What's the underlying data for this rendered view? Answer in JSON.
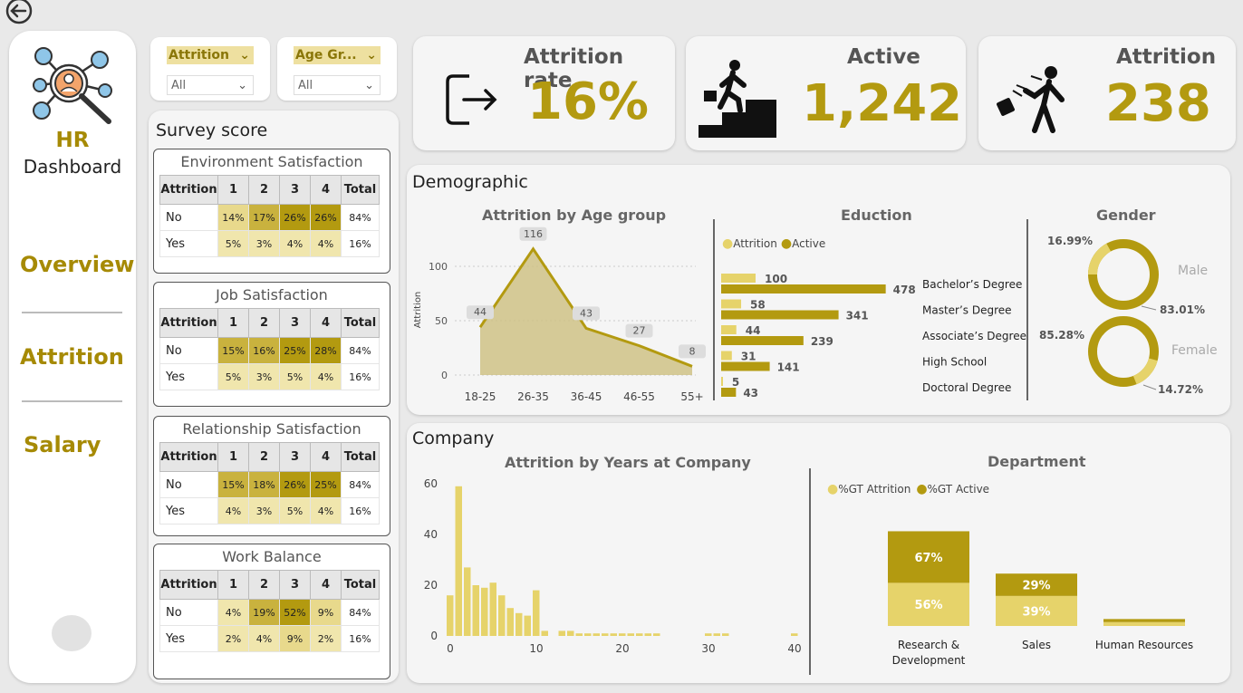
{
  "colors": {
    "gold_dark": "#a68a05",
    "gold_light": "#e6d36a",
    "cell_dark": "#b39a10",
    "cell_mid": "#c9b23e",
    "cell_light": "#e8d98c",
    "cell_pale": "#f0e6ad"
  },
  "sidebar": {
    "logo_title": "HR",
    "logo_sub": "Dashboard",
    "items": [
      {
        "label": "Overview"
      },
      {
        "label": "Attrition"
      },
      {
        "label": "Salary"
      }
    ]
  },
  "filters": [
    {
      "label": "Attrition",
      "value": "All"
    },
    {
      "label": "Age Gr...",
      "value": "All"
    }
  ],
  "survey": {
    "title": "Survey score",
    "columns": [
      "Attrition",
      "1",
      "2",
      "3",
      "4",
      "Total"
    ],
    "tables": [
      {
        "title": "Environment Satisfaction",
        "rows": [
          {
            "label": "No",
            "cells": [
              "14%",
              "17%",
              "26%",
              "26%"
            ],
            "total": "84%"
          },
          {
            "label": "Yes",
            "cells": [
              "5%",
              "3%",
              "4%",
              "4%"
            ],
            "total": "16%"
          }
        ]
      },
      {
        "title": "Job Satisfaction",
        "rows": [
          {
            "label": "No",
            "cells": [
              "15%",
              "16%",
              "25%",
              "28%"
            ],
            "total": "84%"
          },
          {
            "label": "Yes",
            "cells": [
              "5%",
              "3%",
              "5%",
              "4%"
            ],
            "total": "16%"
          }
        ]
      },
      {
        "title": "Relationship Satisfaction",
        "rows": [
          {
            "label": "No",
            "cells": [
              "15%",
              "18%",
              "26%",
              "25%"
            ],
            "total": "84%"
          },
          {
            "label": "Yes",
            "cells": [
              "4%",
              "3%",
              "5%",
              "4%"
            ],
            "total": "16%"
          }
        ]
      },
      {
        "title": "Work Balance",
        "rows": [
          {
            "label": "No",
            "cells": [
              "4%",
              "19%",
              "52%",
              "9%"
            ],
            "total": "84%"
          },
          {
            "label": "Yes",
            "cells": [
              "2%",
              "4%",
              "9%",
              "2%"
            ],
            "total": "16%"
          }
        ]
      }
    ]
  },
  "kpis": [
    {
      "title": "Attrition rate",
      "value": "16%",
      "icon": "exit-icon"
    },
    {
      "title": "Active",
      "value": "1,242",
      "icon": "climbing-stairs-icon"
    },
    {
      "title": "Attrition",
      "value": "238",
      "icon": "leaving-person-icon"
    }
  ],
  "demographic": {
    "title": "Demographic"
  },
  "company": {
    "title": "Company"
  },
  "chart_data": [
    {
      "type": "area",
      "title": "Attrition by Age group",
      "ylabel": "Attrition",
      "xlabel": "",
      "categories": [
        "18-25",
        "26-35",
        "36-45",
        "46-55",
        "55+"
      ],
      "values": [
        44,
        116,
        43,
        27,
        8
      ],
      "yticks": [
        0,
        50,
        100
      ],
      "ylim": [
        0,
        125
      ]
    },
    {
      "type": "bar",
      "title": "Eduction",
      "orientation": "horizontal",
      "categories": [
        "Bachelor's Degree",
        "Master's Degree",
        "Associate's Degree",
        "High School",
        "Doctoral Degree"
      ],
      "series": [
        {
          "name": "Attrition",
          "values": [
            100,
            58,
            44,
            31,
            5
          ]
        },
        {
          "name": "Active",
          "values": [
            478,
            341,
            239,
            141,
            43
          ]
        }
      ],
      "legend": "top-left"
    },
    {
      "type": "pie",
      "title": "Gender",
      "charts": [
        {
          "label": "Male",
          "slices": [
            {
              "label": "16.99%",
              "value": 16.99
            },
            {
              "label": "83.01%",
              "value": 83.01
            }
          ]
        },
        {
          "label": "Female",
          "slices": [
            {
              "label": "85.28%",
              "value": 85.28
            },
            {
              "label": "14.72%",
              "value": 14.72
            }
          ]
        }
      ]
    },
    {
      "type": "bar",
      "title": "Attrition by Years at Company",
      "xticks": [
        0,
        10,
        20,
        30,
        40
      ],
      "yticks": [
        0,
        20,
        40,
        60
      ],
      "ylim": [
        0,
        60
      ],
      "x": [
        0,
        1,
        2,
        3,
        4,
        5,
        6,
        7,
        8,
        9,
        10,
        11,
        12,
        13,
        14,
        15,
        16,
        17,
        18,
        19,
        20,
        21,
        22,
        23,
        24,
        25,
        26,
        27,
        28,
        29,
        30,
        31,
        32,
        33,
        34,
        35,
        36,
        37,
        38,
        39,
        40
      ],
      "values": [
        16,
        59,
        27,
        20,
        19,
        21,
        16,
        11,
        9,
        8,
        18,
        2,
        0,
        2,
        2,
        1,
        1,
        1,
        1,
        1,
        1,
        1,
        1,
        1,
        1,
        0,
        0,
        0,
        0,
        0,
        1,
        1,
        1,
        0,
        0,
        0,
        0,
        0,
        0,
        0,
        1
      ]
    },
    {
      "type": "bar",
      "title": "Department",
      "stacked": true,
      "categories": [
        "Research & Development",
        "Sales",
        "Human Resources"
      ],
      "series": [
        {
          "name": "%GT Attrition",
          "values": [
            56,
            39,
            5
          ]
        },
        {
          "name": "%GT Active",
          "values": [
            67,
            29,
            4
          ]
        }
      ],
      "labels": [
        {
          "attrition": "56%",
          "active": "67%"
        },
        {
          "attrition": "39%",
          "active": "29%"
        },
        {
          "attrition": "",
          "active": ""
        }
      ],
      "legend": "top-left"
    }
  ]
}
